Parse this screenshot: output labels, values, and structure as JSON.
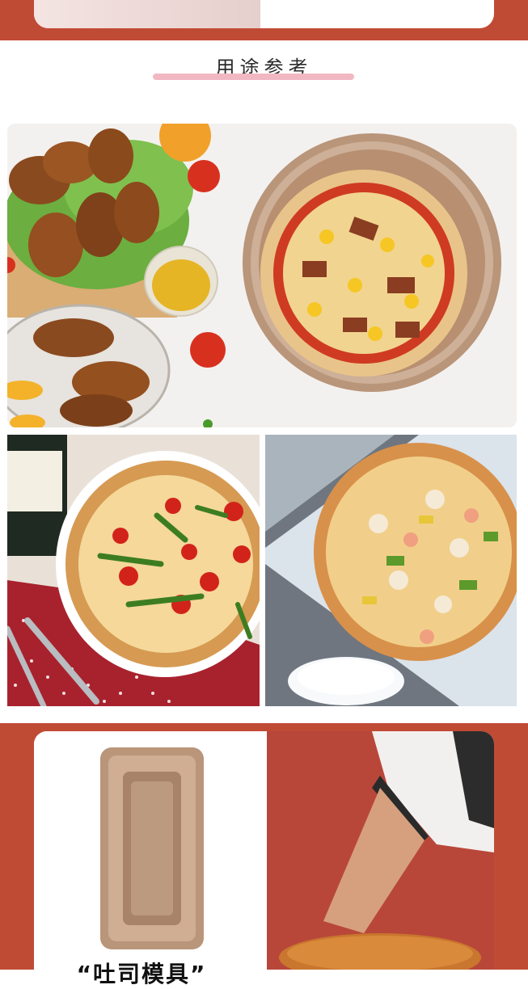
{
  "section": {
    "title": "用途参考"
  },
  "product": {
    "caption": "“吐司模具”"
  },
  "colors": {
    "band_red": "#c04b35",
    "underline_pink": "#f2b8c2",
    "pan_gold": "#b9957a"
  },
  "images": {
    "photo_1": "chicken-wings-and-pizza-on-round-pan",
    "photo_2": "margherita-pizza-with-cherry-tomatoes",
    "photo_3": "seafood-pizza-with-mouse",
    "photo_4": "rectangular-toast-loaf-pan",
    "photo_5": "person-holding-bread"
  }
}
